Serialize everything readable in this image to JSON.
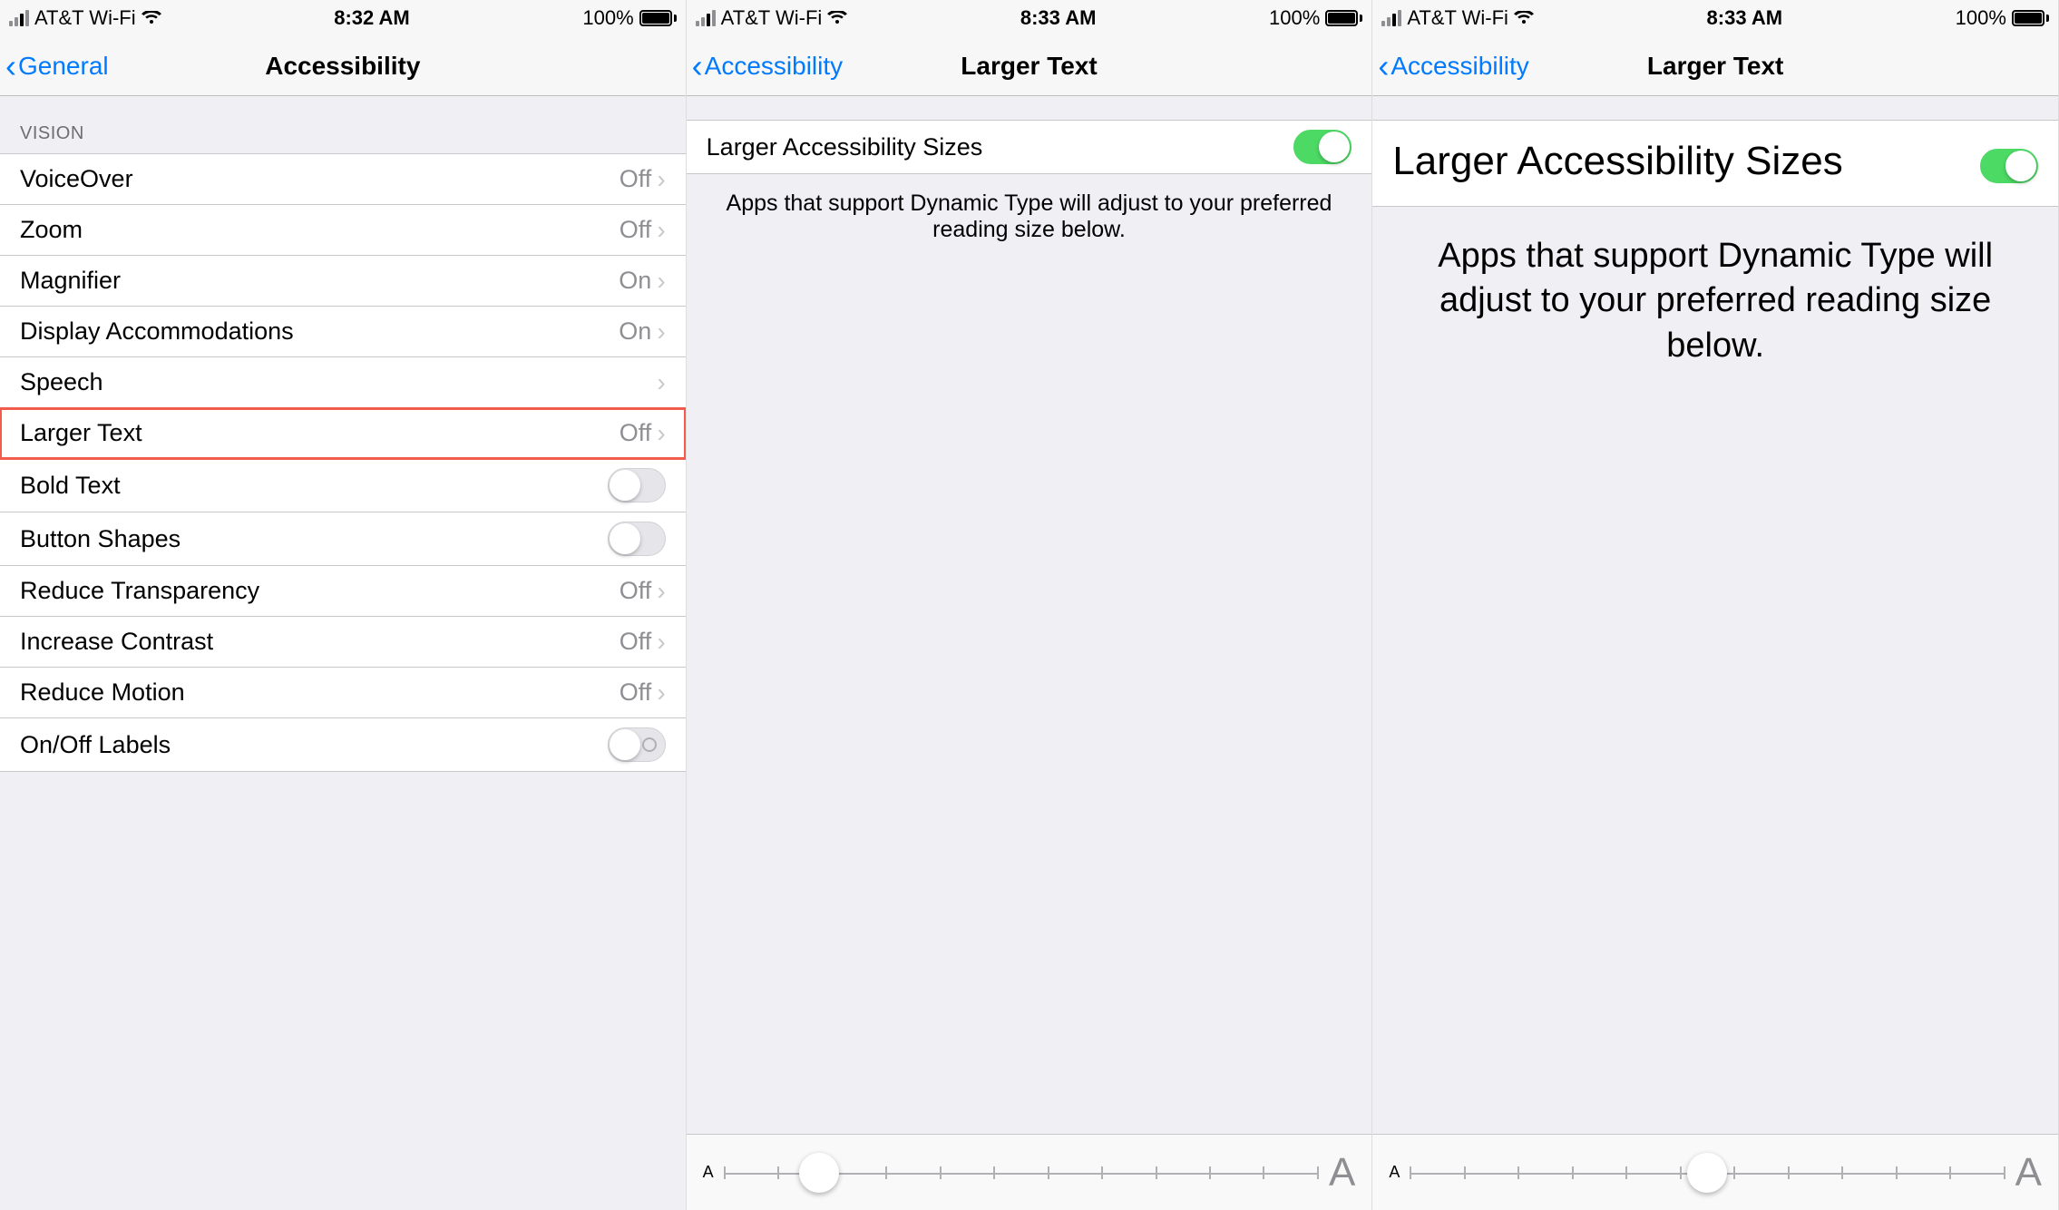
{
  "screens": [
    {
      "status": {
        "carrier": "AT&T Wi-Fi",
        "time": "8:32 AM",
        "battery": "100%"
      },
      "nav": {
        "back": "General",
        "title": "Accessibility"
      },
      "section": "VISION",
      "rows": [
        {
          "label": "VoiceOver",
          "value": "Off",
          "type": "disclosure"
        },
        {
          "label": "Zoom",
          "value": "Off",
          "type": "disclosure"
        },
        {
          "label": "Magnifier",
          "value": "On",
          "type": "disclosure"
        },
        {
          "label": "Display Accommodations",
          "value": "On",
          "type": "disclosure"
        },
        {
          "label": "Speech",
          "value": "",
          "type": "disclosure"
        },
        {
          "label": "Larger Text",
          "value": "Off",
          "type": "disclosure",
          "highlight": true
        },
        {
          "label": "Bold Text",
          "type": "toggle",
          "on": false
        },
        {
          "label": "Button Shapes",
          "type": "toggle",
          "on": false
        },
        {
          "label": "Reduce Transparency",
          "value": "Off",
          "type": "disclosure"
        },
        {
          "label": "Increase Contrast",
          "value": "Off",
          "type": "disclosure"
        },
        {
          "label": "Reduce Motion",
          "value": "Off",
          "type": "disclosure"
        },
        {
          "label": "On/Off Labels",
          "type": "toggle",
          "on": false,
          "labeled": true
        }
      ]
    },
    {
      "status": {
        "carrier": "AT&T Wi-Fi",
        "time": "8:33 AM",
        "battery": "100%"
      },
      "nav": {
        "back": "Accessibility",
        "title": "Larger Text"
      },
      "rows": [
        {
          "label": "Larger Accessibility Sizes",
          "type": "toggle",
          "on": true
        }
      ],
      "description": "Apps that support Dynamic Type will adjust to your preferred reading size below.",
      "slider": {
        "ticks": 12,
        "pos": 0.16,
        "smallA": "A",
        "largeA": "A"
      }
    },
    {
      "status": {
        "carrier": "AT&T Wi-Fi",
        "time": "8:33 AM",
        "battery": "100%"
      },
      "nav": {
        "back": "Accessibility",
        "title": "Larger Text"
      },
      "rows": [
        {
          "label": "Larger Accessibility Sizes",
          "type": "toggle",
          "on": true,
          "big": true
        }
      ],
      "description": "Apps that support Dynamic Type will adjust to your preferred reading size below.",
      "descriptionLarge": true,
      "slider": {
        "ticks": 12,
        "pos": 0.5,
        "smallA": "A",
        "largeA": "A"
      }
    }
  ]
}
